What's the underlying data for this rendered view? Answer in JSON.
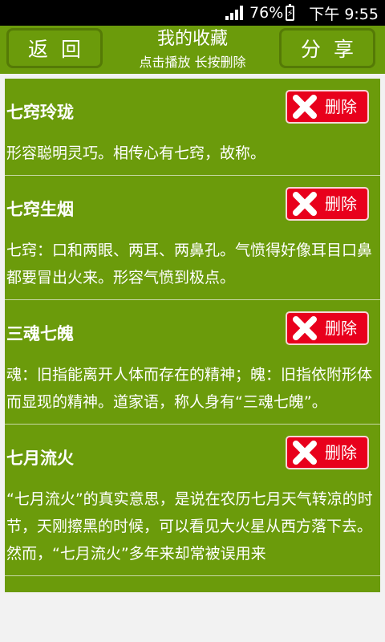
{
  "status_bar": {
    "battery_percent": "76%",
    "battery_level": 0.76,
    "time": "下午 9:55",
    "signal_icon": "signal-icon",
    "battery_icon": "battery-charging-icon"
  },
  "header": {
    "back_label": "返回",
    "title": "我的收藏",
    "subtitle": "点击播放  长按删除",
    "share_label": "分享"
  },
  "delete_label": "删除",
  "items": [
    {
      "title": "七窍玲珑",
      "desc": "形容聪明灵巧。相传心有七窍，故称。"
    },
    {
      "title": "七窍生烟",
      "desc": "七窍：口和两眼、两耳、两鼻孔。气愤得好像耳目口鼻都要冒出火来。形容气愤到极点。"
    },
    {
      "title": "三魂七魄",
      "desc": "魂：旧指能离开人体而存在的精神；魄：旧指依附形体而显现的精神。道家语，称人身有“三魂七魄”。"
    },
    {
      "title": "七月流火",
      "desc": "“七月流火”的真实意思，是说在农历七月天气转凉的时节，天刚擦黑的时候，可以看见大火星从西方落下去。然而，“七月流火”多年来却常被误用来"
    }
  ],
  "colors": {
    "header_bg": "#6b9b0b",
    "delete_bg": "#e8001c",
    "page_bg": "#f2f2f2"
  }
}
